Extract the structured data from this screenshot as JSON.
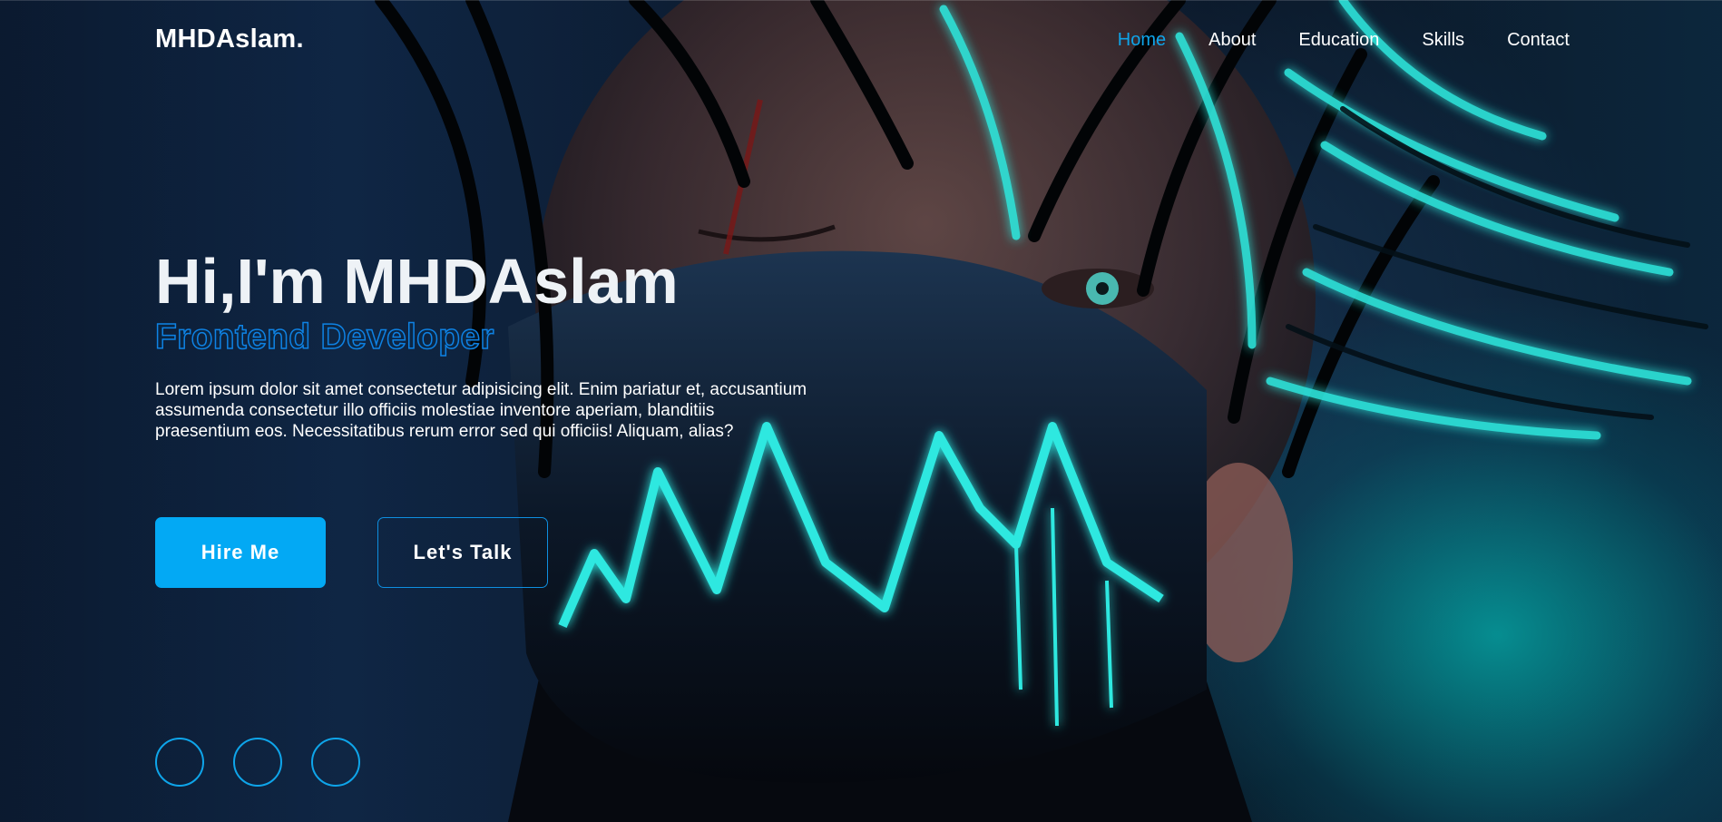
{
  "brand": {
    "logo": "MHDAslam."
  },
  "nav": {
    "items": [
      {
        "label": "Home",
        "active": true
      },
      {
        "label": "About",
        "active": false
      },
      {
        "label": "Education",
        "active": false
      },
      {
        "label": "Skills",
        "active": false
      },
      {
        "label": "Contact",
        "active": false
      }
    ]
  },
  "hero": {
    "title": "Hi,I'm MHDAslam",
    "subtitle": "Frontend Developer",
    "description": "Lorem ipsum dolor sit amet consectetur adipisicing elit. Enim pariatur et, accusantium assumenda consectetur illo officiis molestiae inventore aperiam, blanditiis praesentium eos. Necessitatibus rerum error sed qui officiis! Aliquam, alias?",
    "primary_button": "Hire Me",
    "secondary_button": "Let's Talk"
  },
  "social": {
    "icons": [
      "social-icon-1",
      "social-icon-2",
      "social-icon-3"
    ]
  },
  "colors": {
    "accent": "#03a9f4",
    "nav_active": "#0ea5ea",
    "subtitle_stroke": "#0e82e4",
    "glow": "#2ee8e0"
  }
}
